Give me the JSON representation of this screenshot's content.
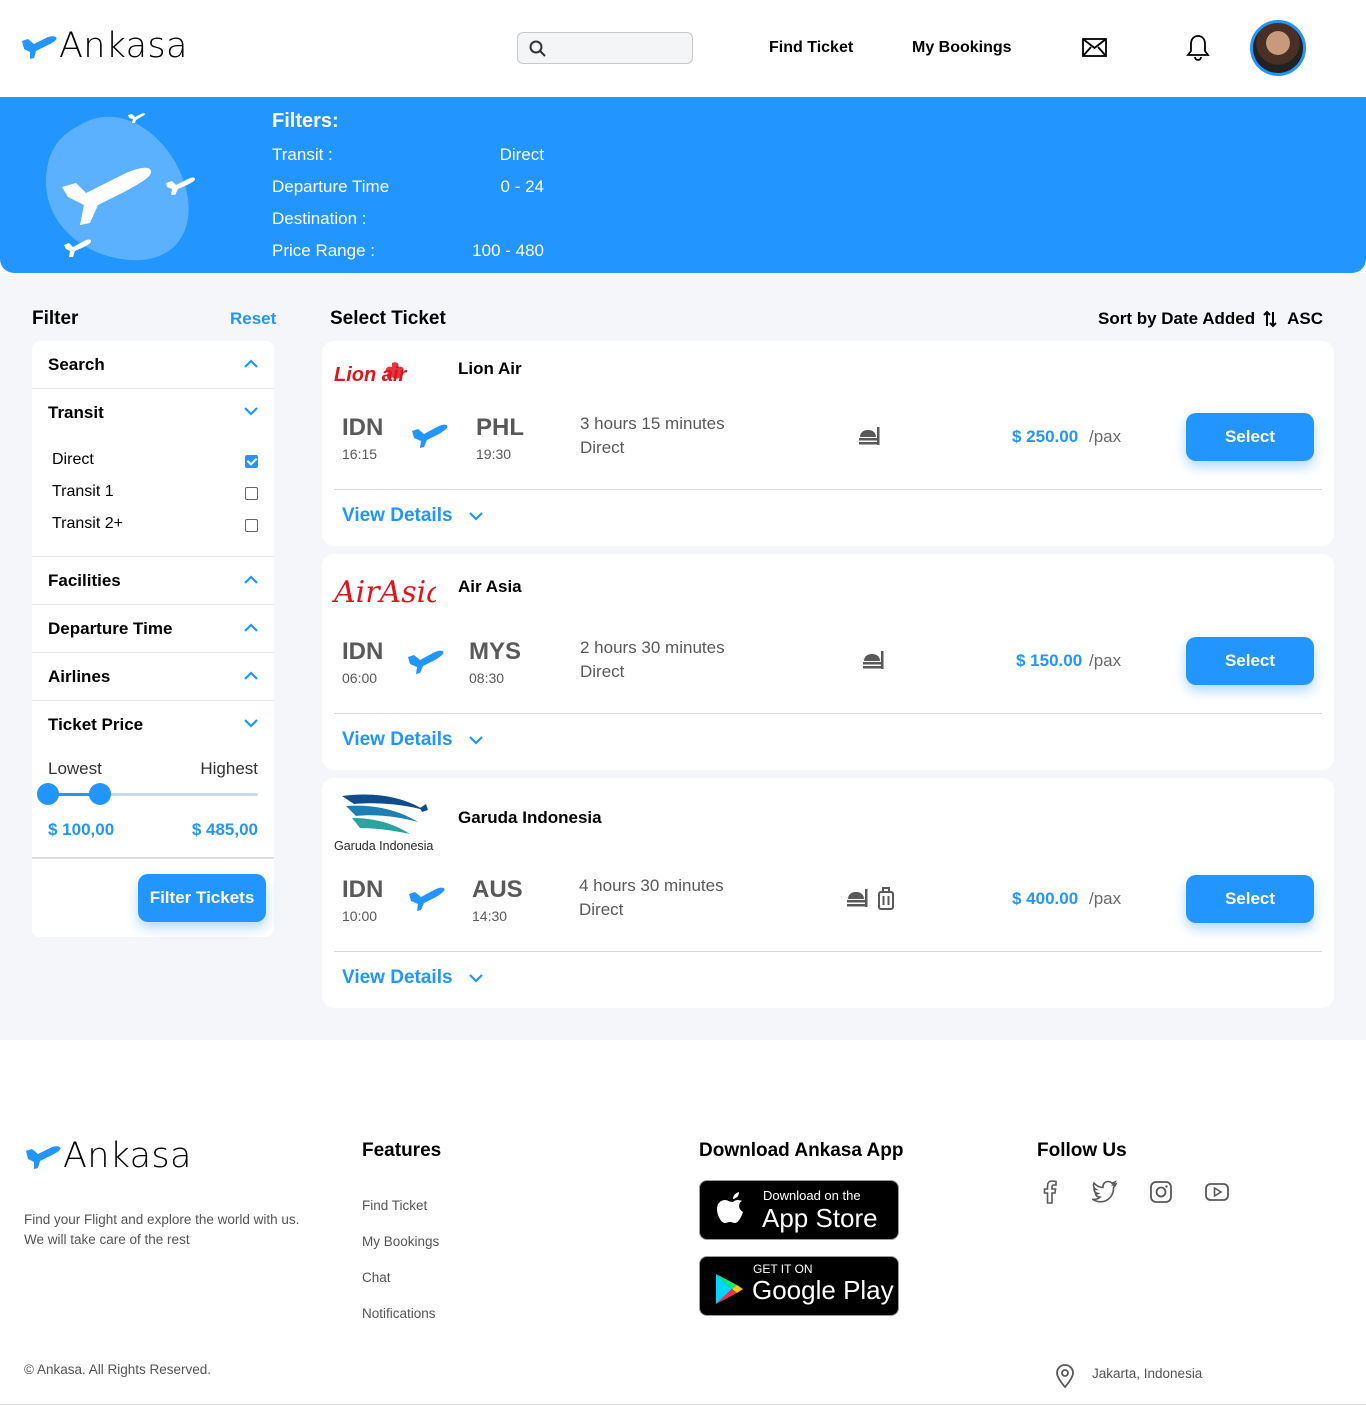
{
  "header": {
    "brand": "Ankasa",
    "search_placeholder": "",
    "nav": [
      "Find Ticket",
      "My Bookings"
    ],
    "accent": "#2395ff"
  },
  "banner": {
    "title": "Filters:",
    "filters": [
      {
        "label": "Transit :",
        "value": "Direct"
      },
      {
        "label": "Departure Time",
        "value": "0 - 24"
      },
      {
        "label": "Destination :",
        "value": ""
      },
      {
        "label": "Price Range :",
        "value": "100 - 480"
      }
    ]
  },
  "filter_panel": {
    "title": "Filter",
    "reset": "Reset",
    "sections": {
      "search": "Search",
      "transit": "Transit",
      "facilities": "Facilities",
      "departure_time": "Departure Time",
      "airlines": "Airlines",
      "ticket_price": "Ticket Price"
    },
    "transit_options": [
      {
        "label": "Direct",
        "checked": true
      },
      {
        "label": "Transit 1",
        "checked": false
      },
      {
        "label": "Transit 2+",
        "checked": false
      }
    ],
    "price": {
      "lowest_label": "Lowest",
      "highest_label": "Highest",
      "min_value": "$ 100,00",
      "max_value": "$ 485,00",
      "low_fraction": 0.0,
      "high_fraction": 0.2
    },
    "button": "Filter Tickets"
  },
  "tickets_header": {
    "title": "Select Ticket",
    "sort_label": "Sort by Date Added",
    "sort_order": "ASC"
  },
  "tickets": [
    {
      "airline": "Lion Air",
      "logo_text": "Lion air",
      "from": "IDN",
      "from_time": "16:15",
      "to": "PHL",
      "to_time": "19:30",
      "duration": "3 hours 15 minutes",
      "transit": "Direct",
      "facilities": [
        "food-icon"
      ],
      "price": "$ 250.00",
      "per": "/pax",
      "select": "Select",
      "details": "View Details"
    },
    {
      "airline": "Air Asia",
      "logo_text": "AirAsia",
      "from": "IDN",
      "from_time": "06:00",
      "to": "MYS",
      "to_time": "08:30",
      "duration": "2 hours 30 minutes",
      "transit": "Direct",
      "facilities": [
        "food-icon"
      ],
      "price": "$ 150.00",
      "per": "/pax",
      "select": "Select",
      "details": "View Details"
    },
    {
      "airline": "Garuda Indonesia",
      "logo_text": "Garuda Indonesia",
      "from": "IDN",
      "from_time": "10:00",
      "to": "AUS",
      "to_time": "14:30",
      "duration": "4 hours 30 minutes",
      "transit": "Direct",
      "facilities": [
        "food-icon",
        "luggage-icon"
      ],
      "price": "$ 400.00",
      "per": "/pax",
      "select": "Select",
      "details": "View Details"
    }
  ],
  "footer": {
    "brand": "Ankasa",
    "tagline_1": "Find your Flight and explore the world with us.",
    "tagline_2": "We will take care of the rest",
    "features_title": "Features",
    "features": [
      "Find Ticket",
      "My Bookings",
      "Chat",
      "Notifications"
    ],
    "download_title": "Download Ankasa App",
    "app_store_small": "Download on the",
    "app_store_big": "App Store",
    "google_small": "GET IT ON",
    "google_big": "Google Play",
    "follow_title": "Follow Us",
    "social": [
      "facebook-icon",
      "twitter-icon",
      "instagram-icon",
      "youtube-icon"
    ],
    "copyright": "© Ankasa. All Rights Reserved.",
    "location": "Jakarta, Indonesia"
  }
}
